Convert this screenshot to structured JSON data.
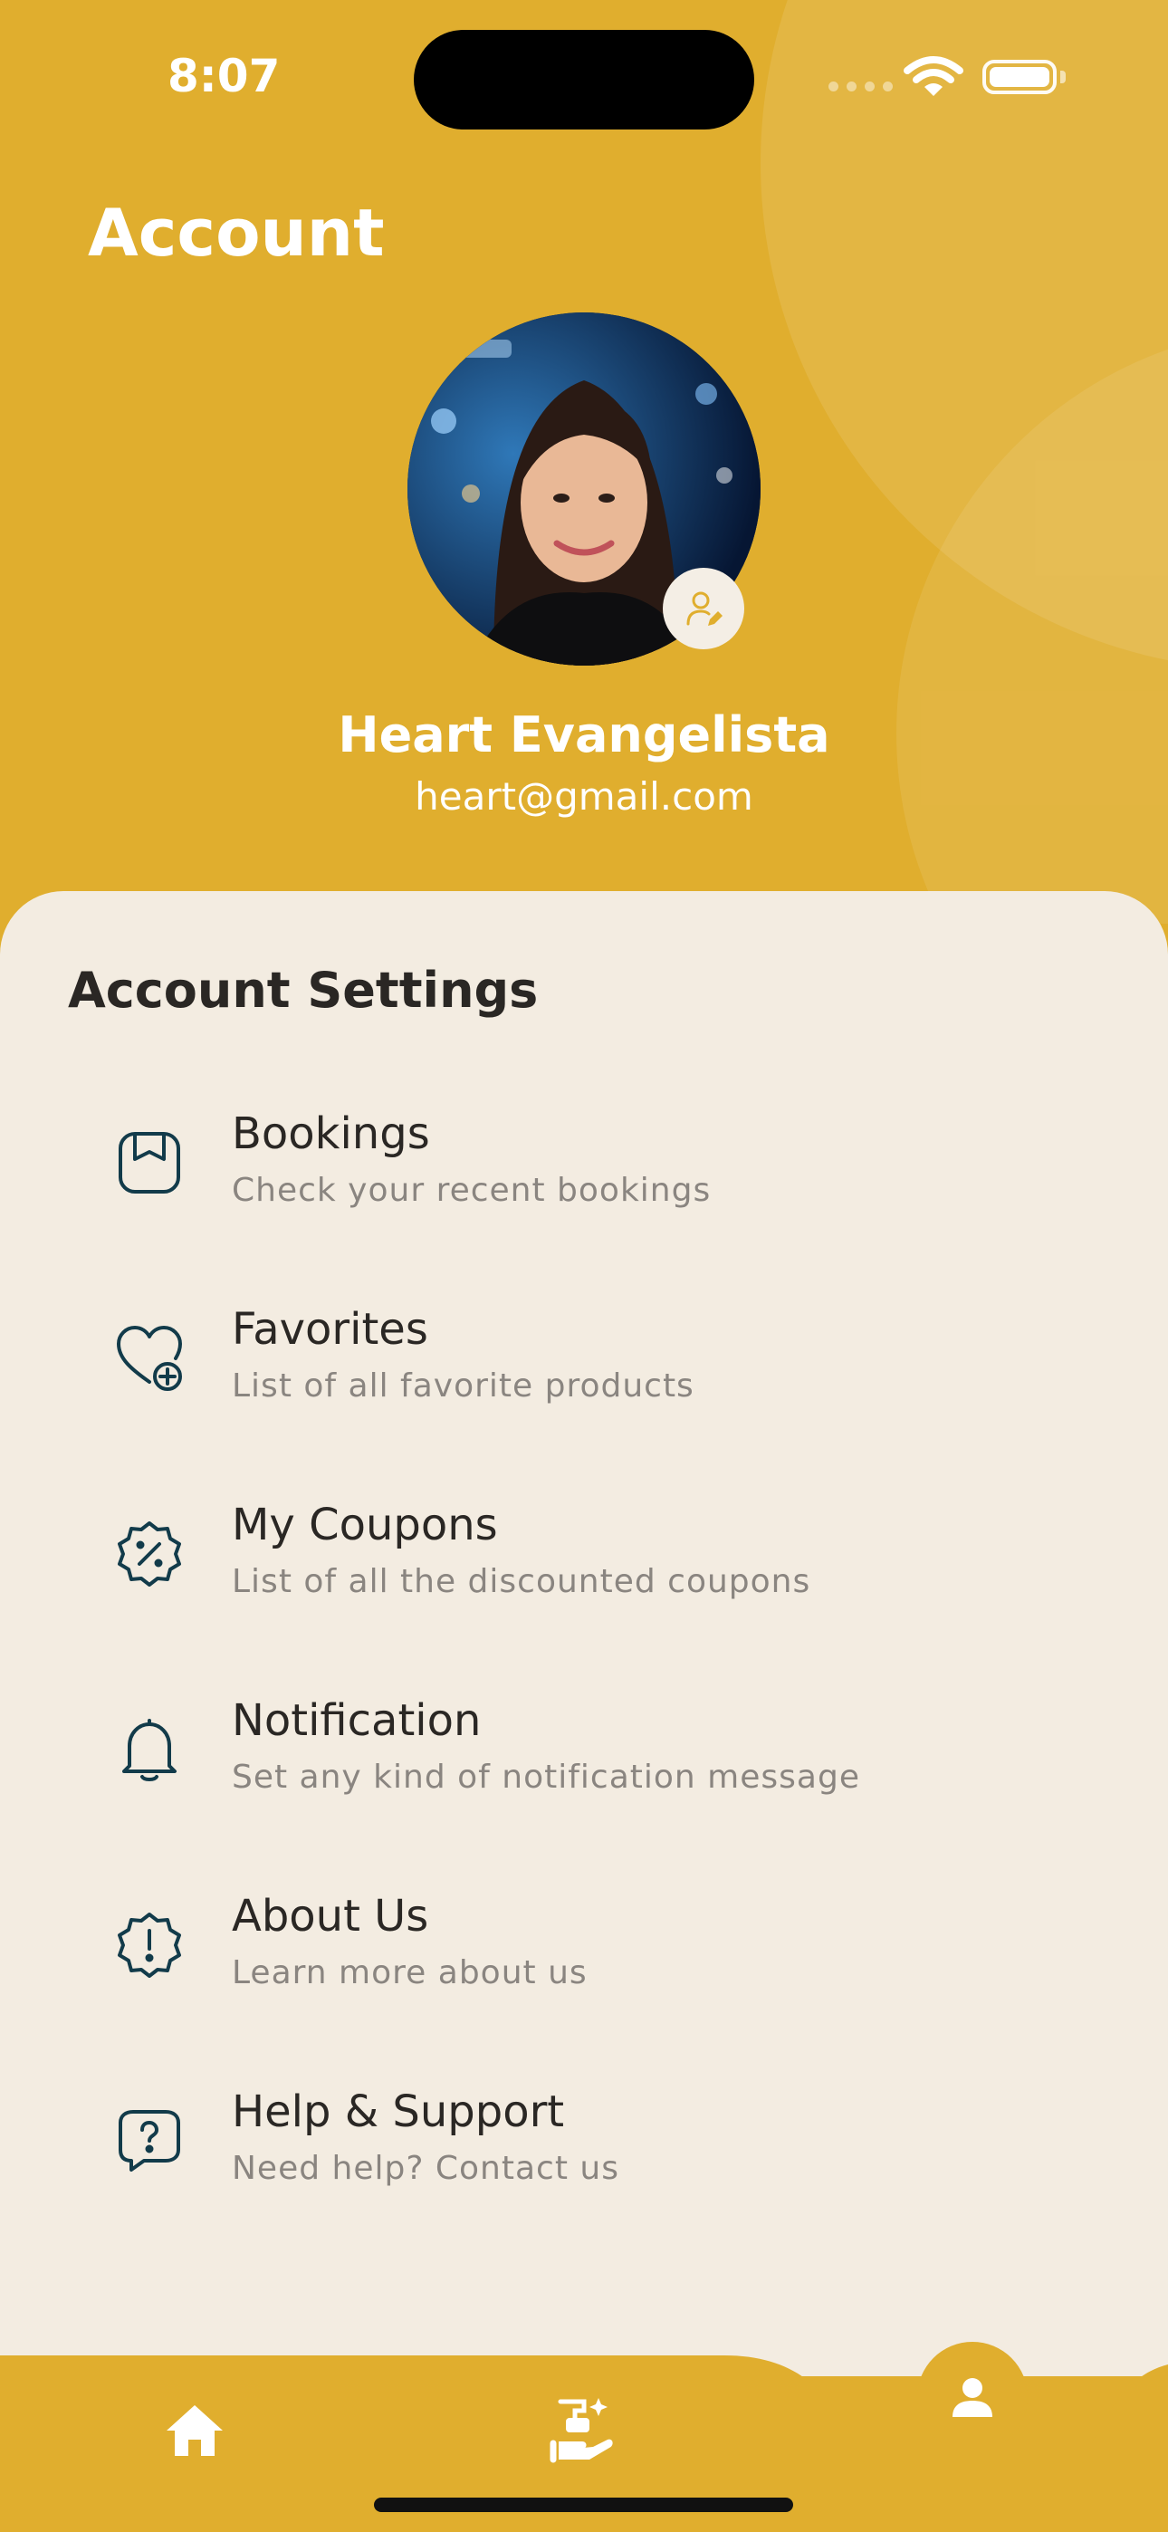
{
  "status_bar": {
    "time": "8:07"
  },
  "header": {
    "title": "Account",
    "user_name": "Heart Evangelista",
    "user_email": "heart@gmail.com"
  },
  "colors": {
    "accent": "#E0AE2E",
    "surface": "#F3ECE1",
    "icon_stroke": "#123B4A",
    "text_primary": "#2a2724",
    "text_secondary": "#8a8580"
  },
  "settings": {
    "title": "Account Settings",
    "items": [
      {
        "label": "Bookings",
        "subtitle": "Check your recent bookings",
        "icon": "bookings-icon"
      },
      {
        "label": "Favorites",
        "subtitle": "List of all favorite products",
        "icon": "heart-plus-icon"
      },
      {
        "label": "My Coupons",
        "subtitle": "List of all the discounted coupons",
        "icon": "discount-badge-icon"
      },
      {
        "label": "Notification",
        "subtitle": "Set any kind of notification message",
        "icon": "bell-icon"
      },
      {
        "label": "About Us",
        "subtitle": "Learn more about us",
        "icon": "info-badge-icon"
      },
      {
        "label": "Help & Support",
        "subtitle": "Need help? Contact us",
        "icon": "help-chat-icon"
      }
    ]
  },
  "nav": {
    "items": [
      "home-icon",
      "services-icon",
      "account-icon"
    ],
    "active": "account-icon"
  }
}
